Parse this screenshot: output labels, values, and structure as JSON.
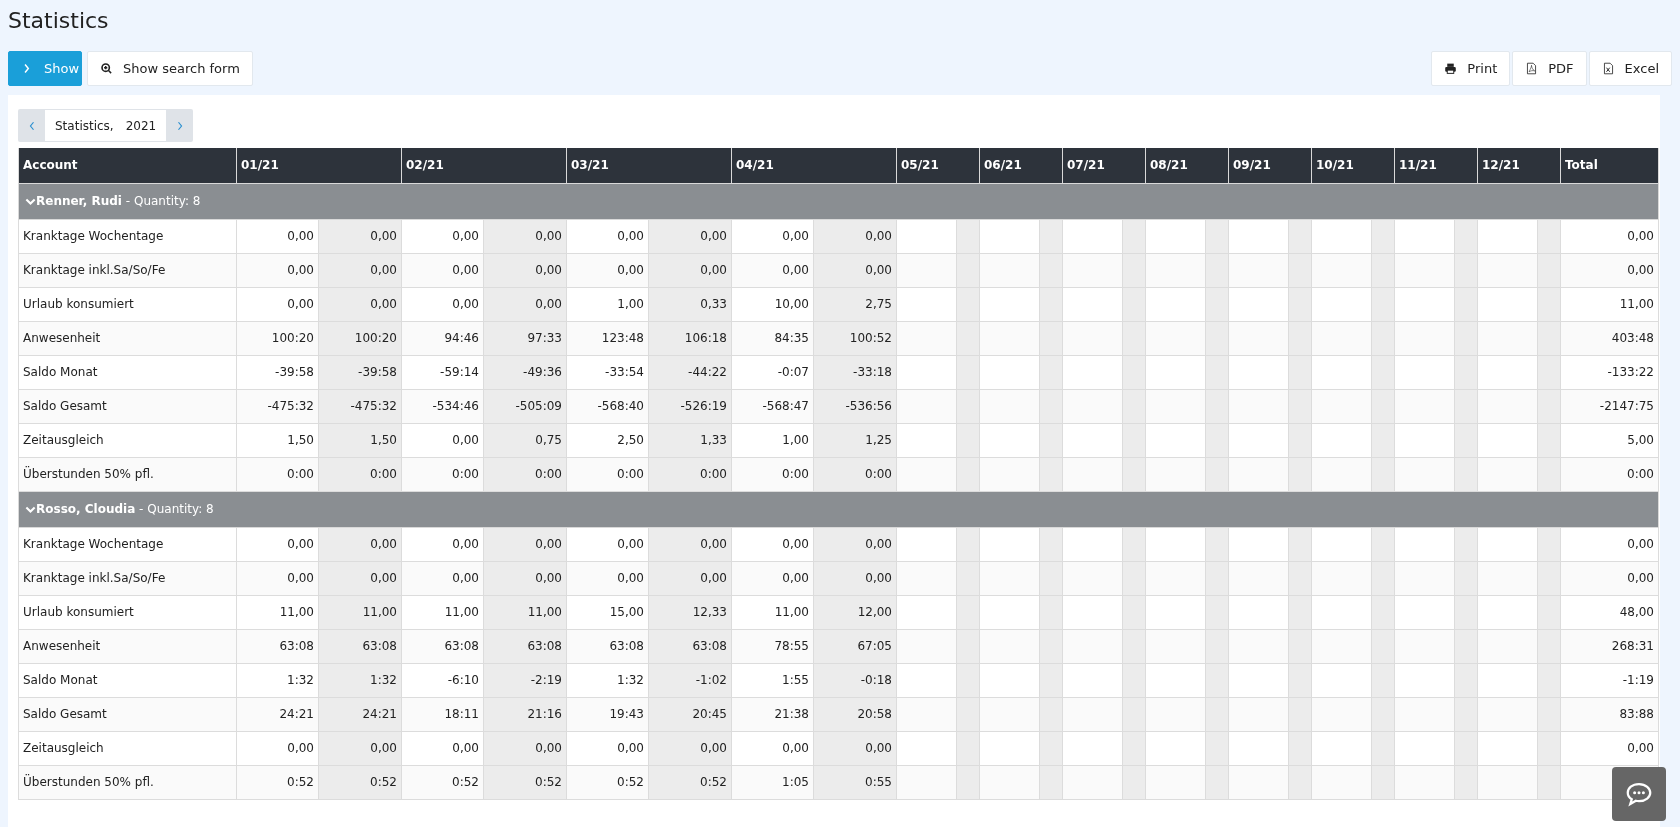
{
  "page_title": "Statistics",
  "toolbar": {
    "left": [
      {
        "kind": "show",
        "label": "Show"
      },
      {
        "kind": "search",
        "label": "Show search form"
      }
    ],
    "right": [
      {
        "kind": "print",
        "label": "Print"
      },
      {
        "kind": "pdf",
        "label": "PDF"
      },
      {
        "kind": "excel",
        "label": "Excel"
      }
    ]
  },
  "period": {
    "title": "Statistics,",
    "year": "2021"
  },
  "table": {
    "columns": [
      {
        "label": "Account",
        "kind": "account"
      },
      {
        "label": "01/21",
        "kind": "filled"
      },
      {
        "label": "02/21",
        "kind": "filled"
      },
      {
        "label": "03/21",
        "kind": "filled"
      },
      {
        "label": "04/21",
        "kind": "filled"
      },
      {
        "label": "05/21",
        "kind": "empty"
      },
      {
        "label": "06/21",
        "kind": "empty"
      },
      {
        "label": "07/21",
        "kind": "empty"
      },
      {
        "label": "08/21",
        "kind": "empty"
      },
      {
        "label": "09/21",
        "kind": "empty"
      },
      {
        "label": "10/21",
        "kind": "empty"
      },
      {
        "label": "11/21",
        "kind": "empty"
      },
      {
        "label": "12/21",
        "kind": "empty"
      },
      {
        "label": "Total",
        "kind": "total"
      }
    ],
    "groups": [
      {
        "heading": "**Renner, Rudi** - Quantity: 8",
        "expanded": true,
        "rows": [
          {
            "label": "Kranktage Wochentage",
            "values": [
              "0,00",
              "0,00",
              "0,00",
              "0,00",
              "0,00",
              "0,00",
              "0,00",
              "0,00"
            ],
            "total": "0,00"
          },
          {
            "label": "Kranktage inkl.Sa/So/Fe",
            "values": [
              "0,00",
              "0,00",
              "0,00",
              "0,00",
              "0,00",
              "0,00",
              "0,00",
              "0,00"
            ],
            "total": "0,00"
          },
          {
            "label": "Urlaub konsumiert",
            "values": [
              "0,00",
              "0,00",
              "0,00",
              "0,00",
              "1,00",
              "0,33",
              "10,00",
              "2,75"
            ],
            "total": "11,00"
          },
          {
            "label": "Anwesenheit",
            "values": [
              "100:20",
              "100:20",
              "94:46",
              "97:33",
              "123:48",
              "106:18",
              "84:35",
              "100:52"
            ],
            "total": "403:48"
          },
          {
            "label": "Saldo Monat",
            "values": [
              "-39:58",
              "-39:58",
              "-59:14",
              "-49:36",
              "-33:54",
              "-44:22",
              "-0:07",
              "-33:18"
            ],
            "total": "-133:22"
          },
          {
            "label": "Saldo Gesamt",
            "values": [
              "-475:32",
              "-475:32",
              "-534:46",
              "-505:09",
              "-568:40",
              "-526:19",
              "-568:47",
              "-536:56"
            ],
            "total": "-2147:75"
          },
          {
            "label": "Zeitausgleich",
            "values": [
              "1,50",
              "1,50",
              "0,00",
              "0,75",
              "2,50",
              "1,33",
              "1,00",
              "1,25"
            ],
            "total": "5,00"
          },
          {
            "label": "Überstunden 50% pfl.",
            "values": [
              "0:00",
              "0:00",
              "0:00",
              "0:00",
              "0:00",
              "0:00",
              "0:00",
              "0:00"
            ],
            "total": "0:00"
          }
        ]
      },
      {
        "heading": "**Rosso, Cloudia** - Quantity: 8",
        "expanded": true,
        "rows": [
          {
            "label": "Kranktage Wochentage",
            "values": [
              "0,00",
              "0,00",
              "0,00",
              "0,00",
              "0,00",
              "0,00",
              "0,00",
              "0,00"
            ],
            "total": "0,00"
          },
          {
            "label": "Kranktage inkl.Sa/So/Fe",
            "values": [
              "0,00",
              "0,00",
              "0,00",
              "0,00",
              "0,00",
              "0,00",
              "0,00",
              "0,00"
            ],
            "total": "0,00"
          },
          {
            "label": "Urlaub konsumiert",
            "values": [
              "11,00",
              "11,00",
              "11,00",
              "11,00",
              "15,00",
              "12,33",
              "11,00",
              "12,00"
            ],
            "total": "48,00"
          },
          {
            "label": "Anwesenheit",
            "values": [
              "63:08",
              "63:08",
              "63:08",
              "63:08",
              "63:08",
              "63:08",
              "78:55",
              "67:05"
            ],
            "total": "268:31"
          },
          {
            "label": "Saldo Monat",
            "values": [
              "1:32",
              "1:32",
              "-6:10",
              "-2:19",
              "1:32",
              "-1:02",
              "1:55",
              "-0:18"
            ],
            "total": "-1:19"
          },
          {
            "label": "Saldo Gesamt",
            "values": [
              "24:21",
              "24:21",
              "18:11",
              "21:16",
              "19:43",
              "20:45",
              "21:38",
              "20:58"
            ],
            "total": "83:88"
          },
          {
            "label": "Zeitausgleich",
            "values": [
              "0,00",
              "0,00",
              "0,00",
              "0,00",
              "0,00",
              "0,00",
              "0,00",
              "0,00"
            ],
            "total": "0,00"
          },
          {
            "label": "Überstunden 50% pfl.",
            "values": [
              "0:52",
              "0:52",
              "0:52",
              "0:52",
              "0:52",
              "0:52",
              "1:05",
              "0:55"
            ]
          }
        ]
      }
    ]
  }
}
